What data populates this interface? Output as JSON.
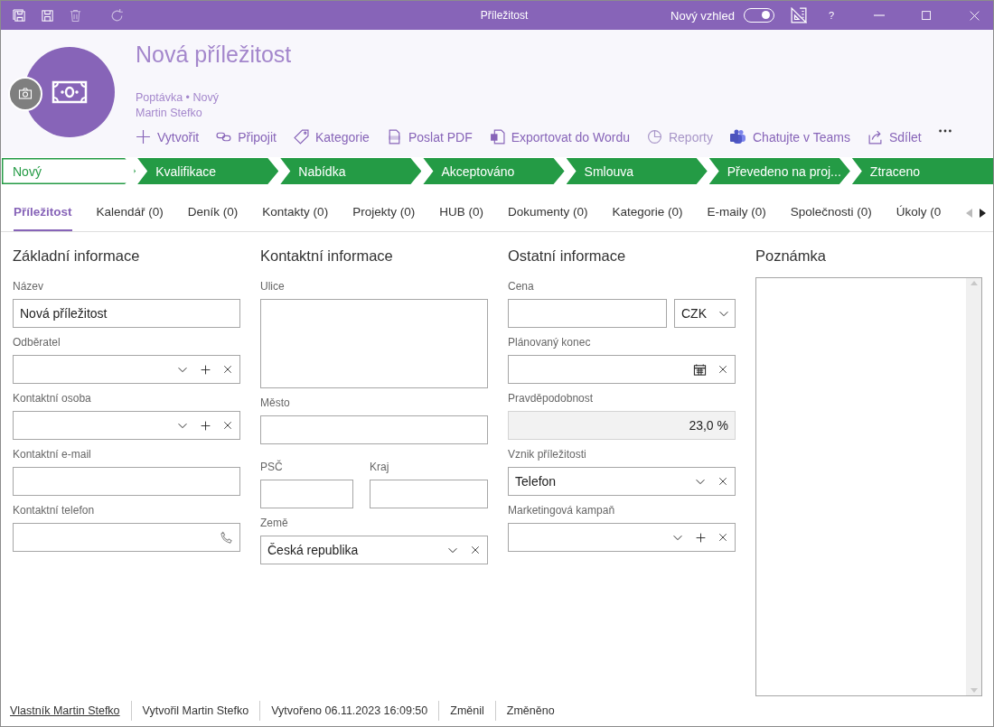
{
  "window": {
    "title": "Příležitost",
    "new_look": {
      "label": "Nový vzhled",
      "on": true
    },
    "help": "?"
  },
  "header": {
    "title": "Nová příležitost",
    "subtitle": "Poptávka • Nový",
    "owner": "Martin Stefko"
  },
  "actions": [
    {
      "label": "Vytvořit",
      "disabled": false
    },
    {
      "label": "Připojit",
      "disabled": false
    },
    {
      "label": "Kategorie",
      "disabled": false
    },
    {
      "label": "Poslat PDF",
      "disabled": false
    },
    {
      "label": "Exportovat do Wordu",
      "disabled": false
    },
    {
      "label": "Reporty",
      "disabled": true
    },
    {
      "label": "Chatujte v Teams",
      "disabled": false
    },
    {
      "label": "Sdílet",
      "disabled": false
    }
  ],
  "stages": [
    {
      "label": "Nový",
      "selected": true
    },
    {
      "label": "Kvalifikace",
      "selected": false
    },
    {
      "label": "Nabídka",
      "selected": false
    },
    {
      "label": "Akceptováno",
      "selected": false
    },
    {
      "label": "Smlouva",
      "selected": false
    },
    {
      "label": "Převedeno na proj...",
      "selected": false
    },
    {
      "label": "Ztraceno",
      "selected": false
    }
  ],
  "tabs": [
    {
      "label": "Příležitost",
      "selected": true
    },
    {
      "label": "Kalendář (0)",
      "selected": false
    },
    {
      "label": "Deník (0)",
      "selected": false
    },
    {
      "label": "Kontakty (0)",
      "selected": false
    },
    {
      "label": "Projekty (0)",
      "selected": false
    },
    {
      "label": "HUB (0)",
      "selected": false
    },
    {
      "label": "Dokumenty (0)",
      "selected": false
    },
    {
      "label": "Kategorie (0)",
      "selected": false
    },
    {
      "label": "E-maily (0)",
      "selected": false
    },
    {
      "label": "Společnosti (0)",
      "selected": false
    },
    {
      "label": "Úkoly (0",
      "selected": false
    }
  ],
  "sections": [
    {
      "title": "Základní informace",
      "fields": [
        {
          "kind": "text",
          "label": "Název",
          "value": "Nová příležitost"
        },
        {
          "kind": "lookup",
          "label": "Odběratel"
        },
        {
          "kind": "lookup",
          "label": "Kontaktní osoba"
        },
        {
          "kind": "text",
          "label": "Kontaktní e-mail"
        },
        {
          "kind": "phone",
          "label": "Kontaktní telefon"
        }
      ]
    },
    {
      "title": "Kontaktní informace",
      "fields": [
        {
          "kind": "textarea",
          "label": "Ulice"
        },
        {
          "kind": "text",
          "label": "Město"
        },
        {
          "kind": "pair",
          "fields": [
            {
              "kind": "text",
              "label": "PSČ"
            },
            {
              "kind": "text",
              "label": "Kraj"
            }
          ]
        },
        {
          "kind": "select",
          "label": "Země",
          "value": "Česká republika"
        }
      ]
    },
    {
      "title": "Ostatní informace",
      "fields": [
        {
          "kind": "price",
          "label": "Cena",
          "currency": "CZK"
        },
        {
          "kind": "date",
          "label": "Plánovaný konec"
        },
        {
          "kind": "readonly",
          "label": "Pravděpodobnost",
          "value": "23,0 %"
        },
        {
          "kind": "select",
          "label": "Vznik příležitosti",
          "value": "Telefon"
        },
        {
          "kind": "lookup",
          "label": "Marketingová kampaň"
        }
      ]
    }
  ],
  "notes": {
    "title": "Poznámka"
  },
  "status_bar": [
    {
      "kind": "link",
      "text": "Vlastník Martin Stefko"
    },
    {
      "kind": "text",
      "text": "Vytvořil Martin Stefko"
    },
    {
      "kind": "text",
      "text": "Vytvořeno 06.11.2023 16:09:50"
    },
    {
      "kind": "text",
      "text": "Změnil"
    },
    {
      "kind": "text",
      "text": "Změněno"
    }
  ]
}
